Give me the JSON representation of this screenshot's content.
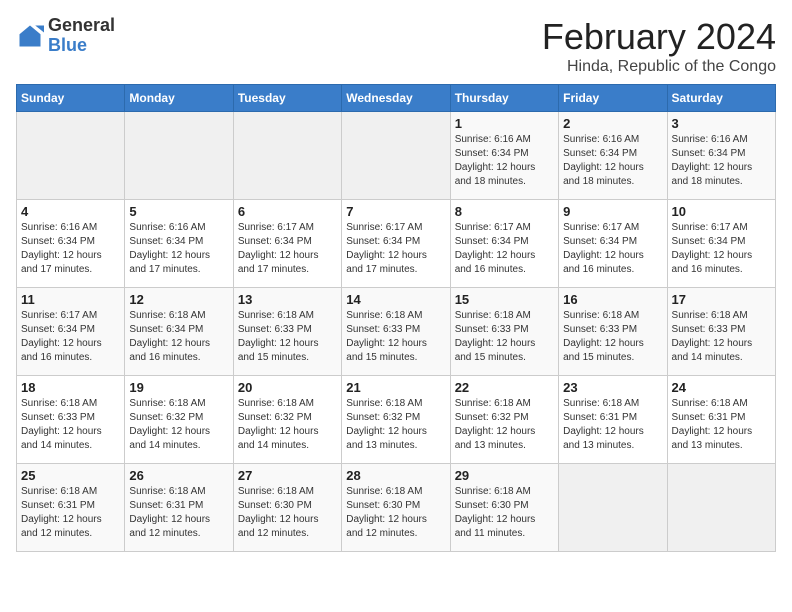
{
  "logo": {
    "general": "General",
    "blue": "Blue"
  },
  "header": {
    "month": "February 2024",
    "location": "Hinda, Republic of the Congo"
  },
  "weekdays": [
    "Sunday",
    "Monday",
    "Tuesday",
    "Wednesday",
    "Thursday",
    "Friday",
    "Saturday"
  ],
  "weeks": [
    [
      {
        "day": "",
        "info": ""
      },
      {
        "day": "",
        "info": ""
      },
      {
        "day": "",
        "info": ""
      },
      {
        "day": "",
        "info": ""
      },
      {
        "day": "1",
        "info": "Sunrise: 6:16 AM\nSunset: 6:34 PM\nDaylight: 12 hours\nand 18 minutes."
      },
      {
        "day": "2",
        "info": "Sunrise: 6:16 AM\nSunset: 6:34 PM\nDaylight: 12 hours\nand 18 minutes."
      },
      {
        "day": "3",
        "info": "Sunrise: 6:16 AM\nSunset: 6:34 PM\nDaylight: 12 hours\nand 18 minutes."
      }
    ],
    [
      {
        "day": "4",
        "info": "Sunrise: 6:16 AM\nSunset: 6:34 PM\nDaylight: 12 hours\nand 17 minutes."
      },
      {
        "day": "5",
        "info": "Sunrise: 6:16 AM\nSunset: 6:34 PM\nDaylight: 12 hours\nand 17 minutes."
      },
      {
        "day": "6",
        "info": "Sunrise: 6:17 AM\nSunset: 6:34 PM\nDaylight: 12 hours\nand 17 minutes."
      },
      {
        "day": "7",
        "info": "Sunrise: 6:17 AM\nSunset: 6:34 PM\nDaylight: 12 hours\nand 17 minutes."
      },
      {
        "day": "8",
        "info": "Sunrise: 6:17 AM\nSunset: 6:34 PM\nDaylight: 12 hours\nand 16 minutes."
      },
      {
        "day": "9",
        "info": "Sunrise: 6:17 AM\nSunset: 6:34 PM\nDaylight: 12 hours\nand 16 minutes."
      },
      {
        "day": "10",
        "info": "Sunrise: 6:17 AM\nSunset: 6:34 PM\nDaylight: 12 hours\nand 16 minutes."
      }
    ],
    [
      {
        "day": "11",
        "info": "Sunrise: 6:17 AM\nSunset: 6:34 PM\nDaylight: 12 hours\nand 16 minutes."
      },
      {
        "day": "12",
        "info": "Sunrise: 6:18 AM\nSunset: 6:34 PM\nDaylight: 12 hours\nand 16 minutes."
      },
      {
        "day": "13",
        "info": "Sunrise: 6:18 AM\nSunset: 6:33 PM\nDaylight: 12 hours\nand 15 minutes."
      },
      {
        "day": "14",
        "info": "Sunrise: 6:18 AM\nSunset: 6:33 PM\nDaylight: 12 hours\nand 15 minutes."
      },
      {
        "day": "15",
        "info": "Sunrise: 6:18 AM\nSunset: 6:33 PM\nDaylight: 12 hours\nand 15 minutes."
      },
      {
        "day": "16",
        "info": "Sunrise: 6:18 AM\nSunset: 6:33 PM\nDaylight: 12 hours\nand 15 minutes."
      },
      {
        "day": "17",
        "info": "Sunrise: 6:18 AM\nSunset: 6:33 PM\nDaylight: 12 hours\nand 14 minutes."
      }
    ],
    [
      {
        "day": "18",
        "info": "Sunrise: 6:18 AM\nSunset: 6:33 PM\nDaylight: 12 hours\nand 14 minutes."
      },
      {
        "day": "19",
        "info": "Sunrise: 6:18 AM\nSunset: 6:32 PM\nDaylight: 12 hours\nand 14 minutes."
      },
      {
        "day": "20",
        "info": "Sunrise: 6:18 AM\nSunset: 6:32 PM\nDaylight: 12 hours\nand 14 minutes."
      },
      {
        "day": "21",
        "info": "Sunrise: 6:18 AM\nSunset: 6:32 PM\nDaylight: 12 hours\nand 13 minutes."
      },
      {
        "day": "22",
        "info": "Sunrise: 6:18 AM\nSunset: 6:32 PM\nDaylight: 12 hours\nand 13 minutes."
      },
      {
        "day": "23",
        "info": "Sunrise: 6:18 AM\nSunset: 6:31 PM\nDaylight: 12 hours\nand 13 minutes."
      },
      {
        "day": "24",
        "info": "Sunrise: 6:18 AM\nSunset: 6:31 PM\nDaylight: 12 hours\nand 13 minutes."
      }
    ],
    [
      {
        "day": "25",
        "info": "Sunrise: 6:18 AM\nSunset: 6:31 PM\nDaylight: 12 hours\nand 12 minutes."
      },
      {
        "day": "26",
        "info": "Sunrise: 6:18 AM\nSunset: 6:31 PM\nDaylight: 12 hours\nand 12 minutes."
      },
      {
        "day": "27",
        "info": "Sunrise: 6:18 AM\nSunset: 6:30 PM\nDaylight: 12 hours\nand 12 minutes."
      },
      {
        "day": "28",
        "info": "Sunrise: 6:18 AM\nSunset: 6:30 PM\nDaylight: 12 hours\nand 12 minutes."
      },
      {
        "day": "29",
        "info": "Sunrise: 6:18 AM\nSunset: 6:30 PM\nDaylight: 12 hours\nand 11 minutes."
      },
      {
        "day": "",
        "info": ""
      },
      {
        "day": "",
        "info": ""
      }
    ]
  ]
}
